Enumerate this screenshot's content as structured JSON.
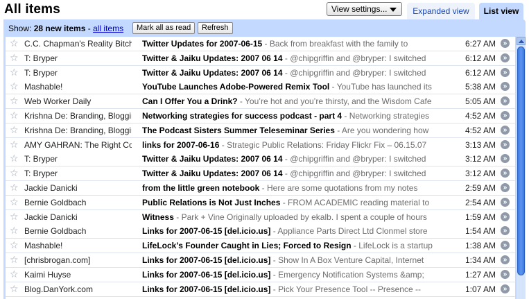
{
  "header": {
    "title": "All items",
    "view_settings_label": "View settings...",
    "tab_expanded": "Expanded view",
    "tab_list": "List view"
  },
  "toolbar": {
    "show_prefix": "Show:",
    "new_items": "28 new items",
    "separator": " - ",
    "all_items_link": "all items",
    "mark_all_read": "Mark all as read",
    "refresh": "Refresh"
  },
  "colors": {
    "accent": "#c3d9ff",
    "link": "#0000cc",
    "scroll_thumb": "#3e7be0"
  },
  "items": [
    {
      "source": "C.C. Chapman's Reality Bitch",
      "title": "Twitter Updates for 2007-06-15",
      "snippet": " - Back from breakfast with the family to",
      "time": "6:27 AM"
    },
    {
      "source": "T: Bryper",
      "title": "Twitter & Jaiku Updates: 2007 06 14",
      "snippet": " - @chipgriffin and @bryper: I switched",
      "time": "6:12 AM"
    },
    {
      "source": "T: Bryper",
      "title": "Twitter & Jaiku Updates: 2007 06 14",
      "snippet": " - @chipgriffin and @bryper: I switched",
      "time": "6:12 AM"
    },
    {
      "source": "Mashable!",
      "title": "YouTube Launches Adobe-Powered Remix Tool",
      "snippet": " - YouTube has launched its",
      "time": "5:38 AM"
    },
    {
      "source": "Web Worker Daily",
      "title": "Can I Offer You a Drink?",
      "snippet": " - You’re hot and you’re thirsty, and the Wisdom Cafe",
      "time": "5:05 AM"
    },
    {
      "source": "Krishna De: Branding, Blogging",
      "title": "Networking strategies for success podcast - part 4",
      "snippet": " - Networking strategies",
      "time": "4:52 AM"
    },
    {
      "source": "Krishna De: Branding, Blogging",
      "title": "The Podcast Sisters Summer Teleseminar Series",
      "snippet": " - Are you wondering how",
      "time": "4:52 AM"
    },
    {
      "source": "AMY GAHRAN: The Right Conversation",
      "title": "links for 2007-06-16",
      "snippet": " - Strategic Public Relations: Friday Flickr Fix – 06.15.07",
      "time": "3:13 AM"
    },
    {
      "source": "T: Bryper",
      "title": "Twitter & Jaiku Updates: 2007 06 14",
      "snippet": " - @chipgriffin and @bryper: I switched",
      "time": "3:12 AM"
    },
    {
      "source": "T: Bryper",
      "title": "Twitter & Jaiku Updates: 2007 06 14",
      "snippet": " - @chipgriffin and @bryper: I switched",
      "time": "3:12 AM"
    },
    {
      "source": "Jackie Danicki",
      "title": "from the little green notebook",
      "snippet": " - Here are some quotations from my notes",
      "time": "2:59 AM"
    },
    {
      "source": "Bernie Goldbach",
      "title": "Public Relations is Not Just Inches",
      "snippet": " - FROM ACADEMIC reading material to",
      "time": "2:54 AM"
    },
    {
      "source": "Jackie Danicki",
      "title": "Witness",
      "snippet": " - Park + Vine Originally uploaded by ekalb. I spent a couple of hours",
      "time": "1:59 AM"
    },
    {
      "source": "Bernie Goldbach",
      "title": "Links for 2007-06-15 [del.icio.us]",
      "snippet": " - Appliance Parts Direct Ltd Clonmel store",
      "time": "1:54 AM"
    },
    {
      "source": "Mashable!",
      "title": "LifeLock’s Founder Caught in Lies; Forced to Resign",
      "snippet": " - LifeLock is a startup",
      "time": "1:38 AM"
    },
    {
      "source": "[chrisbrogan.com]",
      "title": "Links for 2007-06-15 [del.icio.us]",
      "snippet": " - Show In A Box Venture Capital, Internet",
      "time": "1:34 AM"
    },
    {
      "source": "Kaimi Huyse",
      "title": "Links for 2007-06-15 [del.icio.us]",
      "snippet": " - Emergency Notification Systems &amp;",
      "time": "1:27 AM"
    },
    {
      "source": "Blog.DanYork.com",
      "title": "Links for 2007-06-15 [del.icio.us]",
      "snippet": " - Pick Your Presence Tool -- Presence --",
      "time": "1:07 AM"
    }
  ]
}
